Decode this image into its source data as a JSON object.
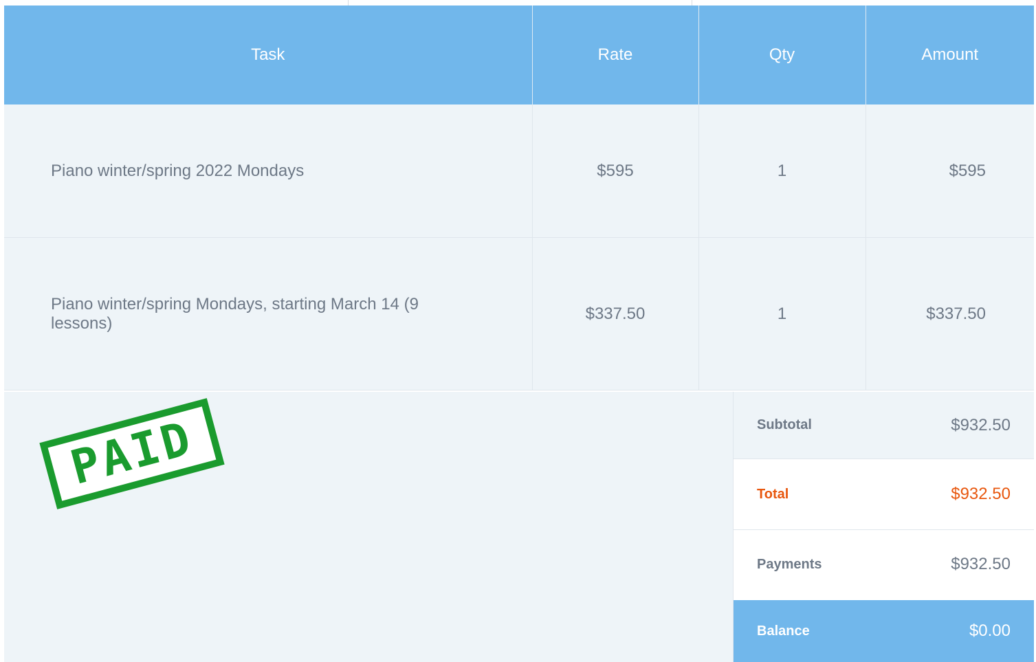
{
  "table": {
    "headers": {
      "task": "Task",
      "rate": "Rate",
      "qty": "Qty",
      "amount": "Amount"
    },
    "rows": [
      {
        "task": "Piano winter/spring 2022 Mondays",
        "rate": "$595",
        "qty": "1",
        "amount": "$595"
      },
      {
        "task": "Piano winter/spring Mondays, starting March 14 (9 lessons)",
        "rate": "$337.50",
        "qty": "1",
        "amount": "$337.50"
      }
    ]
  },
  "stamp": {
    "text": "PAID",
    "color": "#1a9b2e"
  },
  "totals": {
    "subtotal": {
      "label": "Subtotal",
      "value": "$932.50"
    },
    "total": {
      "label": "Total",
      "value": "$932.50"
    },
    "payments": {
      "label": "Payments",
      "value": "$932.50"
    },
    "balance": {
      "label": "Balance",
      "value": "$0.00"
    }
  },
  "colors": {
    "header_bg": "#71b7eb",
    "row_bg": "#eef4f8",
    "text": "#6d7886",
    "total_accent": "#e8570e"
  }
}
